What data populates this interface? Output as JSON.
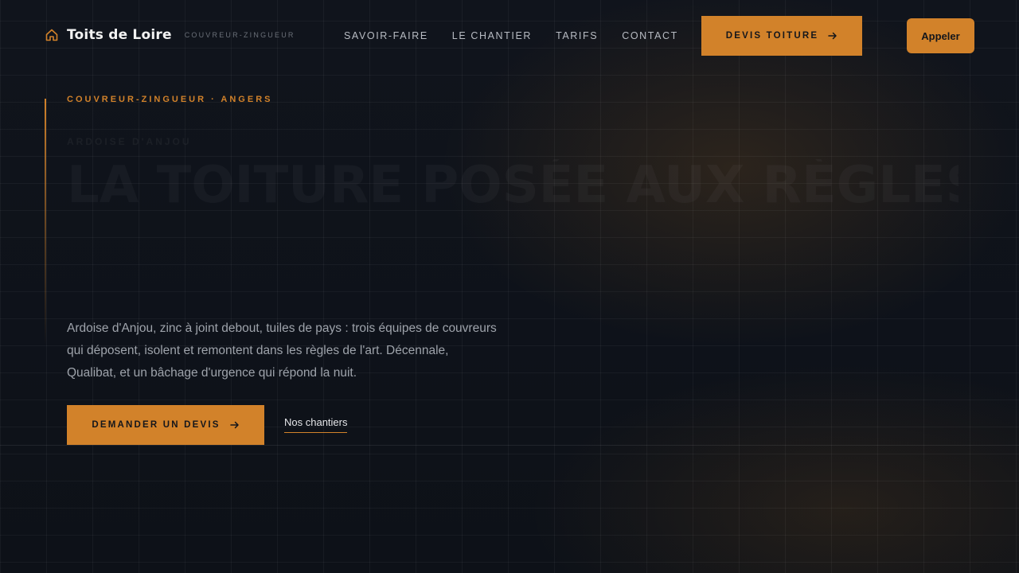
{
  "colors": {
    "accent": "#d2822a",
    "background": "#0d1118"
  },
  "header": {
    "brand_name": "Toits de Loire",
    "brand_tagline": "COUVREUR-ZINGUEUR",
    "brand_icon": "house-icon",
    "nav": [
      {
        "label": "SAVOIR-FAIRE"
      },
      {
        "label": "LE CHANTIER"
      },
      {
        "label": "TARIFS"
      },
      {
        "label": "CONTACT"
      }
    ],
    "devis_label": "DEVIS TOITURE",
    "call_label": "Appeler"
  },
  "hero": {
    "eyebrow": "COUVREUR-ZINGUEUR · ANGERS",
    "ghost_kicker": "ARDOISE D'ANJOU",
    "ghost_title": "LA TOITURE POSÉE AUX RÈGLES",
    "lead": "Ardoise d'Anjou, zinc à joint debout, tuiles de pays : trois équipes de couvreurs qui déposent, isolent et remontent dans les règles de l'art. Décennale, Qualibat, et un bâchage d'urgence qui répond la nuit.",
    "cta_label": "DEMANDER UN DEVIS",
    "secondary_link": "Nos chantiers"
  }
}
